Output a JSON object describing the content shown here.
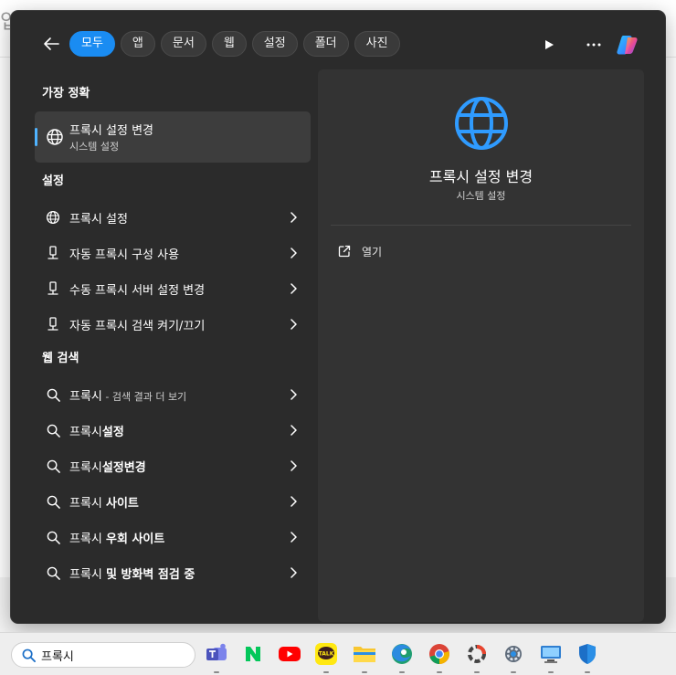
{
  "background": {
    "partial_text": "입"
  },
  "tabs": [
    {
      "label": "모두",
      "active": true
    },
    {
      "label": "앱"
    },
    {
      "label": "문서"
    },
    {
      "label": "웹"
    },
    {
      "label": "설정"
    },
    {
      "label": "폴더"
    },
    {
      "label": "사진"
    }
  ],
  "sections": {
    "best_match": "가장 정확",
    "settings": "설정",
    "web_search": "웹 검색"
  },
  "best_match": {
    "title": "프록시 설정 변경",
    "subtitle": "시스템 설정"
  },
  "settings_items": [
    {
      "label": "프록시 설정",
      "icon": "globe-icon"
    },
    {
      "label": "자동 프록시 구성 사용",
      "icon": "proxy-icon"
    },
    {
      "label": "수동 프록시 서버 설정 변경",
      "icon": "proxy-icon"
    },
    {
      "label": "자동 프록시 검색 켜기/끄기",
      "icon": "proxy-icon"
    }
  ],
  "web_items": [
    {
      "query": "프록시",
      "suffix": " - 검색 결과 더 보기"
    },
    {
      "query": "프록시",
      "bold": "설정"
    },
    {
      "query": "프록시",
      "bold": "설정변경"
    },
    {
      "query": "프록시 ",
      "bold": "사이트"
    },
    {
      "query": "프록시 ",
      "bold": "우회 사이트"
    },
    {
      "query": "프록시 ",
      "bold": "및 방화벽 점검 중"
    }
  ],
  "detail": {
    "title": "프록시 설정 변경",
    "subtitle": "시스템 설정",
    "open_label": "열기"
  },
  "taskbar": {
    "search_value": "프록시",
    "apps": [
      "teams-icon",
      "naver-icon",
      "youtube-icon",
      "kakaotalk-icon",
      "file-explorer-icon",
      "edge-icon",
      "chrome-icon",
      "app-icon",
      "settings-icon",
      "remote-desktop-icon",
      "defender-icon"
    ],
    "kakaotalk_text": "TALK"
  },
  "colors": {
    "accent": "#1a8cf2",
    "panel": "#2b2b2b",
    "detail": "#333333"
  }
}
